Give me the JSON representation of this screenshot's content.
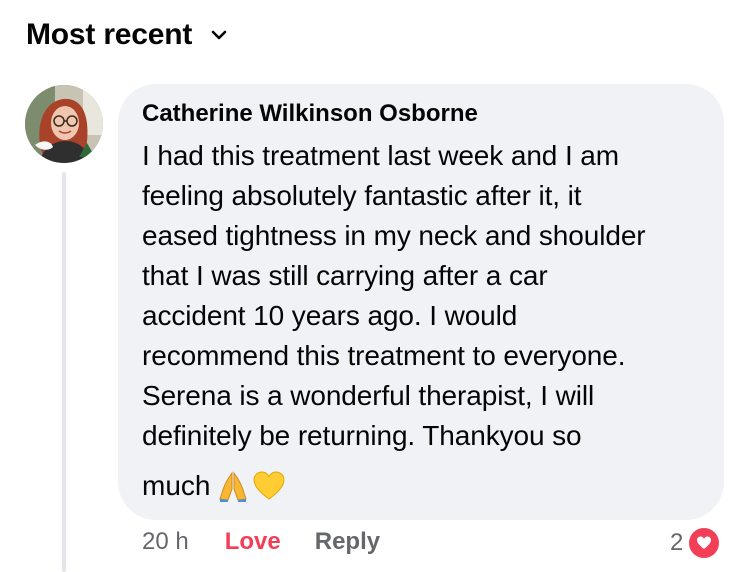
{
  "sort": {
    "label": "Most recent",
    "icon": "chevron-down-icon"
  },
  "comment": {
    "author": "Catherine Wilkinson Osborne",
    "text": "I had this treatment last week and I am\nfeeling absolutely fantastic after it, it\neased tightness in my neck and shoulder\nthat I was still carrying after a car\naccident 10 years ago. I would\nrecommend this treatment to everyone.\nSerena is a wonderful therapist, I will\ndefinitely be returning. Thankyou so",
    "last_word": "much",
    "emojis": [
      "folded-hands-emoji",
      "yellow-heart-emoji"
    ],
    "time": "20 h",
    "reaction_label": "Love",
    "reply_label": "Reply",
    "reaction_count": "2",
    "reaction_icon": "heart-icon"
  },
  "colors": {
    "bubble": "#f0f2f5",
    "love": "#f33e58",
    "secondary_text": "#65676b",
    "thread_line": "#e4e6eb"
  }
}
